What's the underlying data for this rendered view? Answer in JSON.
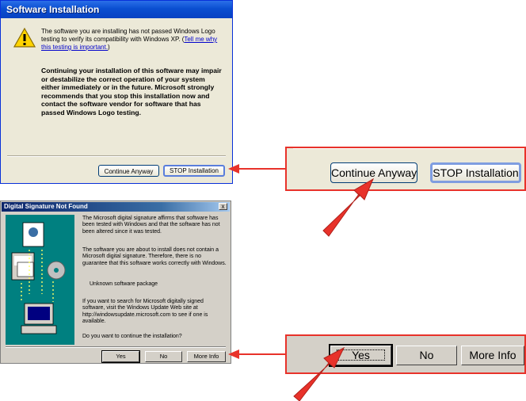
{
  "xp_dialog": {
    "title": "Software Installation",
    "message_part1": "The software you are installing has not passed Windows Logo testing to verify its compatibility with Windows XP. (",
    "link": "Tell me why this testing is important.",
    "message_part1_end": ")",
    "warning_text": "Continuing your installation of this software may impair or destabilize the correct operation of your system either immediately or in the future. Microsoft strongly recommends that you stop this installation now and contact the software vendor for software that has passed Windows Logo testing.",
    "continue_button": "Continue Anyway",
    "stop_button": "STOP Installation"
  },
  "classic_dialog": {
    "title": "Digital Signature Not Found",
    "close_glyph": "x",
    "paragraph1": "The Microsoft digital signature affirms that software has been tested with Windows and that the software has not been altered since it was tested.",
    "paragraph2": "The software you are about to install does not contain a Microsoft digital signature. Therefore,  there is no guarantee that this software works correctly with Windows.",
    "package": "Unknown software package",
    "paragraph3": "If you want to search for Microsoft digitally signed software, visit the Windows Update Web site at http://windowsupdate.microsoft.com to see if one is available.",
    "question": "Do you want to continue the installation?",
    "yes_button": "Yes",
    "no_button": "No",
    "more_info_button": "More Info"
  },
  "zoom_xp": {
    "continue_button": "Continue Anyway",
    "stop_button": "STOP Installation"
  },
  "zoom_classic": {
    "yes_button": "Yes",
    "no_button": "No",
    "more_info_button": "More Info"
  },
  "colors": {
    "callout_red": "#e8322a",
    "xp_face": "#ece9d8",
    "classic_face": "#d4d0c8",
    "xp_titlebar": "#0a4fd1",
    "classic_titlebar": "#0a246a",
    "wizard_panel": "#008080"
  },
  "icons": [
    "warning-icon",
    "install-graphic",
    "arrow-icon"
  ]
}
